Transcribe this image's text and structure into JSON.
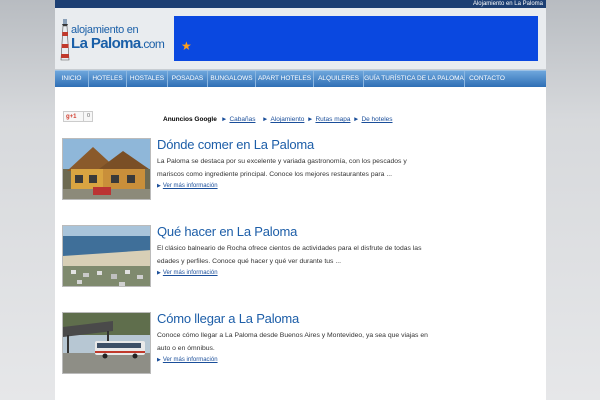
{
  "topbar": {
    "text": "Alojamiento en La Paloma"
  },
  "logo": {
    "line1": "alojamiento en",
    "line2_main": "La Paloma",
    "line2_suffix": ".com"
  },
  "banner": {
    "color": "#0a48e0",
    "star_icon": "star-icon"
  },
  "nav": {
    "items": [
      "INICIO",
      "HOTELES",
      "HOSTALES",
      "POSADAS",
      "BUNGALOWS",
      "APART HOTELES",
      "ALQUILERES",
      "GUÍA TURÍSTICA DE LA PALOMA",
      "CONTACTO"
    ]
  },
  "social": {
    "gplus_label": "g+1",
    "count": "0"
  },
  "ads": {
    "title": "Anuncios Google",
    "links": [
      "Cabañas",
      "Alojamiento",
      "Rutas mapa",
      "De hoteles"
    ]
  },
  "articles": [
    {
      "title": "Dónde comer en La Paloma",
      "desc": "La Paloma se destaca por su excelente y variada gastronomía, con los pescados y mariscos como ingrediente principal. Conoce los mejores restaurantes para ...",
      "more": "Ver más información"
    },
    {
      "title": "Qué hacer en La Paloma",
      "desc": "El clásico balneario de Rocha ofrece cientos de actividades para el disfrute de todas las edades y perfiles. Conoce qué hacer y qué ver durante tus ...",
      "more": "Ver más información"
    },
    {
      "title": "Cómo llegar a La Paloma",
      "desc": "Conoce cómo llegar a La Paloma desde Buenos Aires y Montevideo, ya sea que viajas en auto o en ómnibus.",
      "more": "Ver más información"
    }
  ],
  "colors": {
    "nav_top": "#6ea6dc",
    "nav_bottom": "#2f6fb5",
    "link": "#1d5ea8",
    "topbar": "#1c3f73"
  }
}
